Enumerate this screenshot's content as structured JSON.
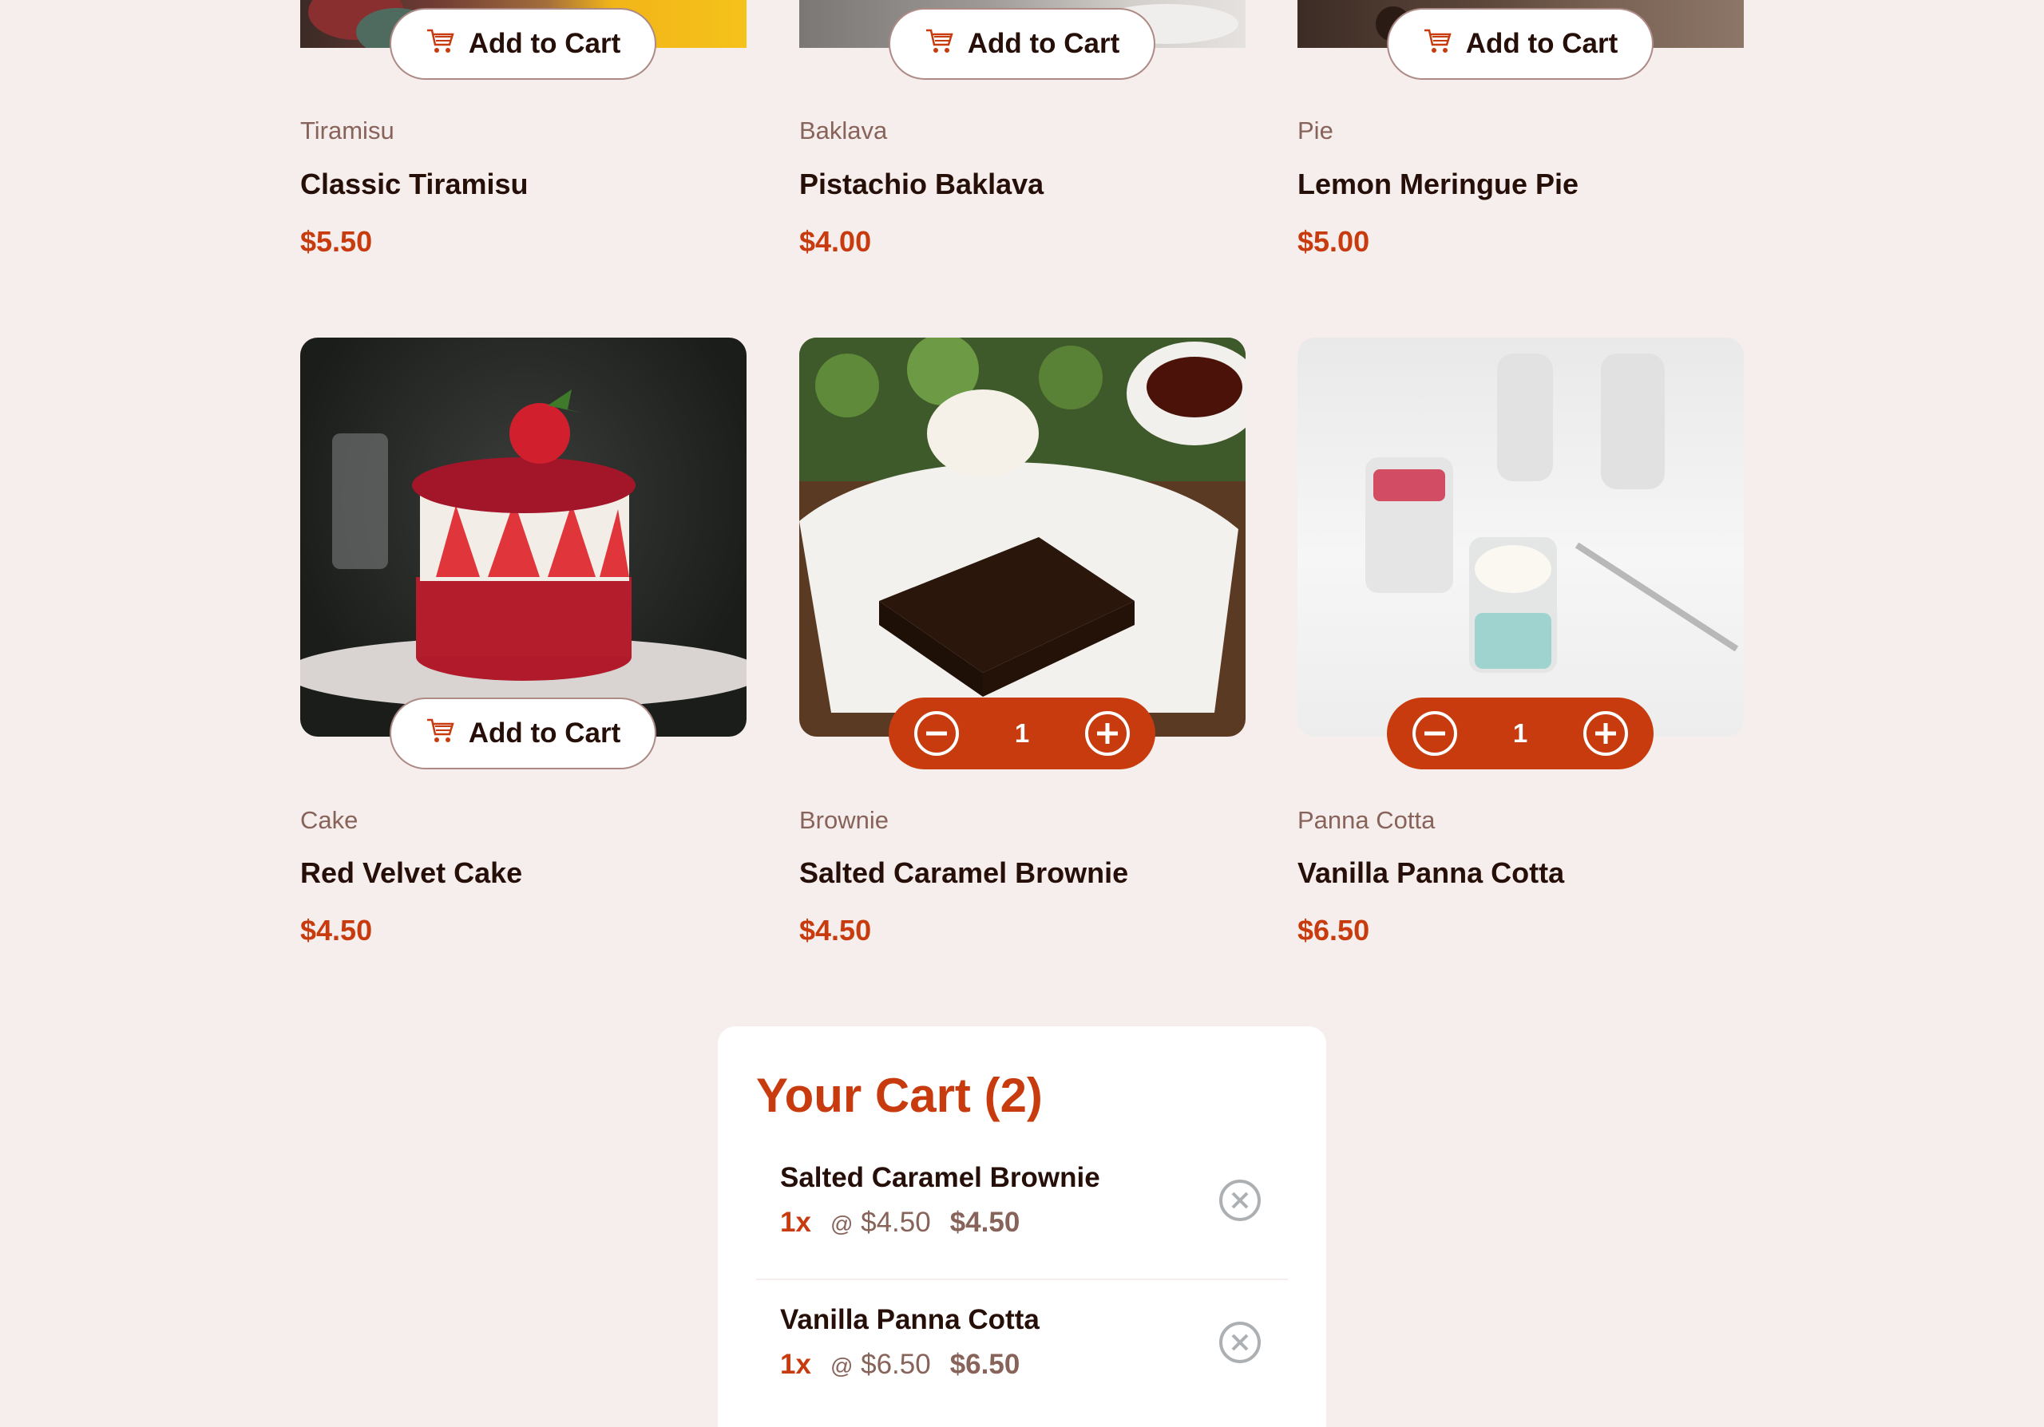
{
  "colors": {
    "background": "#f5eeec",
    "accent": "#c73b0f",
    "text": "#260f08",
    "muted": "#87635a",
    "cart_bg": "#ffffff"
  },
  "icons": {
    "cart_icon": "cart-icon",
    "minus_icon": "minus-circle-icon",
    "plus_icon": "plus-circle-icon",
    "remove_icon": "remove-circle-icon"
  },
  "products": [
    {
      "category": "Tiramisu",
      "name": "Classic Tiramisu",
      "price": "$5.50",
      "button": "Add to Cart"
    },
    {
      "category": "Baklava",
      "name": "Pistachio Baklava",
      "price": "$4.00",
      "button": "Add to Cart"
    },
    {
      "category": "Pie",
      "name": "Lemon Meringue Pie",
      "price": "$5.00",
      "button": "Add to Cart"
    },
    {
      "category": "Cake",
      "name": "Red Velvet Cake",
      "price": "$4.50",
      "button": "Add to Cart"
    },
    {
      "category": "Brownie",
      "name": "Salted Caramel Brownie",
      "price": "$4.50",
      "quantity": "1"
    },
    {
      "category": "Panna Cotta",
      "name": "Vanilla Panna Cotta",
      "price": "$6.50",
      "quantity": "1"
    }
  ],
  "cart": {
    "title": "Your Cart (2)",
    "items": [
      {
        "name": "Salted Caramel Brownie",
        "qty": "1x",
        "unit_prefix": "@",
        "unit_price": "$4.50",
        "total": "$4.50"
      },
      {
        "name": "Vanilla Panna Cotta",
        "qty": "1x",
        "unit_prefix": "@",
        "unit_price": "$6.50",
        "total": "$6.50"
      }
    ]
  }
}
